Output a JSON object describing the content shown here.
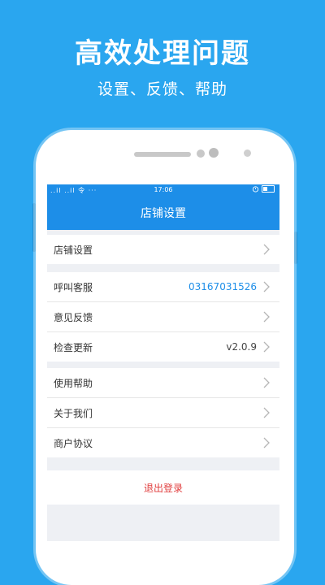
{
  "promo": {
    "title": "高效处理问题",
    "subtitle": "设置、反馈、帮助"
  },
  "statusbar": {
    "left_icons": "..il ..il 令 ···",
    "time": "17:06"
  },
  "navbar": {
    "title": "店铺设置"
  },
  "groups": [
    {
      "items": [
        {
          "label": "店铺设置",
          "value": ""
        }
      ]
    },
    {
      "items": [
        {
          "label": "呼叫客服",
          "value": "03167031526"
        },
        {
          "label": "意见反馈",
          "value": ""
        },
        {
          "label": "检查更新",
          "value": "v2.0.9"
        }
      ]
    },
    {
      "items": [
        {
          "label": "使用帮助",
          "value": ""
        },
        {
          "label": "关于我们",
          "value": ""
        },
        {
          "label": "商户协议",
          "value": ""
        }
      ]
    }
  ],
  "logout_label": "退出登录",
  "colors": {
    "background": "#2aa6ef",
    "header": "#1d8ee8",
    "accent_value": "#1d8ee8",
    "logout": "#e03c3c"
  },
  "icons": [
    "chevron-right-icon",
    "battery-icon",
    "alarm-icon",
    "signal-icon",
    "wifi-icon"
  ]
}
